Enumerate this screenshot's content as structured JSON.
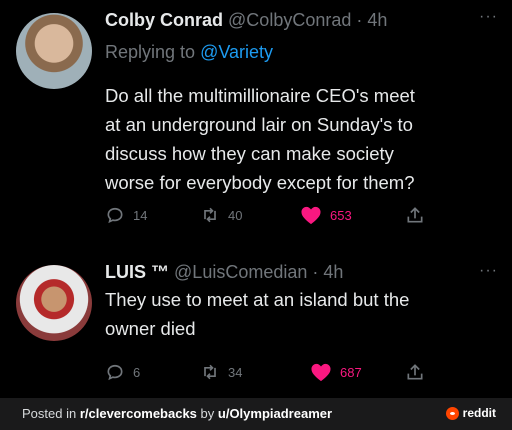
{
  "tweets": [
    {
      "name": "Colby Conrad",
      "handle": "@ColbyConrad",
      "time": "· 4h",
      "replying_label": "Replying to",
      "replying_to": "@Variety",
      "text_lines": [
        "Do all the multimillionaire CEO's meet",
        "at an underground lair on Sunday's to",
        "discuss how they can make society",
        "worse for everybody except for them?"
      ],
      "replies": "14",
      "retweets": "40",
      "likes": "653"
    },
    {
      "name": "LUIS ™",
      "handle": "@LuisComedian",
      "time": "· 4h",
      "text_lines": [
        "They use to meet at an island but the",
        "owner died"
      ],
      "replies": "6",
      "retweets": "34",
      "likes": "687"
    }
  ],
  "more_label": "···",
  "footer": {
    "prefix": "Posted in ",
    "subreddit": "r/clevercomebacks",
    "by": " by ",
    "user": "u/Olympiadreamer",
    "brand": "reddit"
  },
  "colors": {
    "background": "#000000",
    "muted": "#71767b",
    "link": "#1d9bf0",
    "like": "#f91880",
    "reddit": "#ff4500"
  },
  "icons": [
    "reply-icon",
    "retweet-icon",
    "heart-icon",
    "share-icon",
    "reddit-logo-icon"
  ]
}
